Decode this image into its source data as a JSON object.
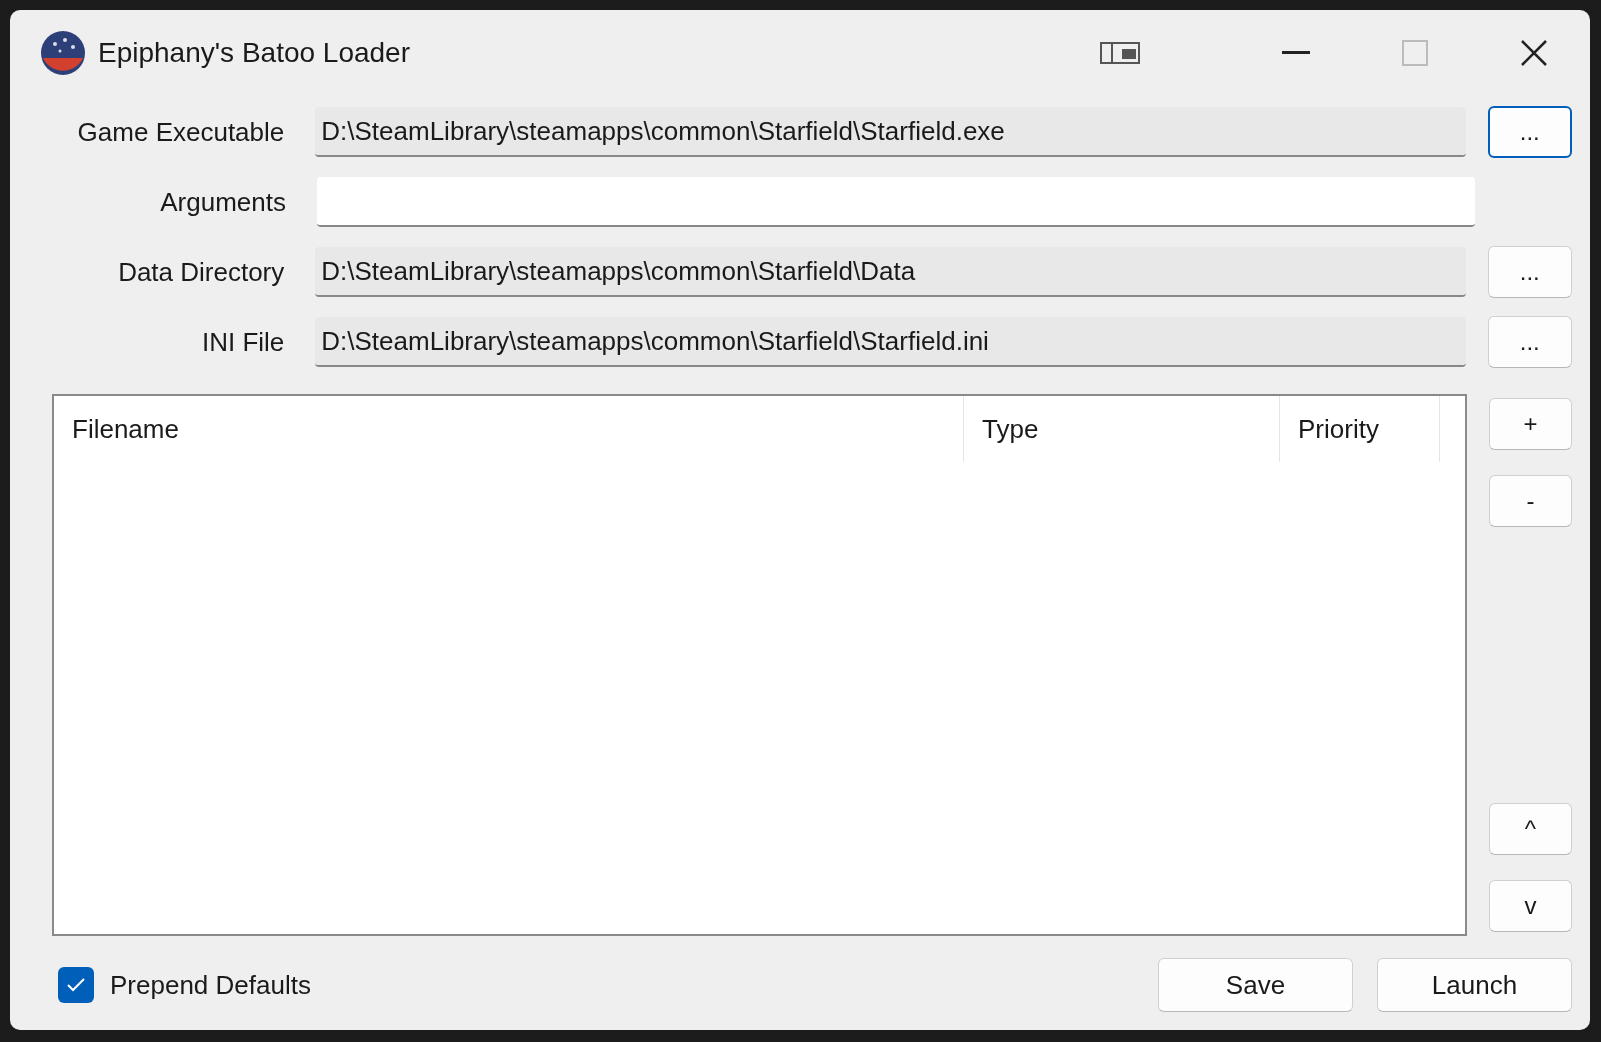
{
  "window": {
    "title": "Epiphany's Batoo Loader"
  },
  "fields": [
    {
      "label": "Game Executable",
      "value": "D:\\SteamLibrary\\steamapps\\common\\Starfield\\Starfield.exe",
      "readonly": true,
      "browse": {
        "label": "...",
        "focused": true
      }
    },
    {
      "label": "Arguments",
      "readonly": false
    },
    {
      "label": "Data Directory",
      "value": "D:\\SteamLibrary\\steamapps\\common\\Starfield\\Data",
      "readonly": true,
      "browse": {
        "label": "...",
        "focused": false
      }
    },
    {
      "label": "INI File",
      "value": "D:\\SteamLibrary\\steamapps\\common\\Starfield\\Starfield.ini",
      "readonly": true,
      "browse": {
        "label": "...",
        "focused": false
      }
    }
  ],
  "table": {
    "columns": [
      "Filename",
      "Type",
      "Priority"
    ]
  },
  "side_buttons": {
    "top": [
      "+",
      "-"
    ],
    "bottom": [
      "^",
      "v"
    ]
  },
  "prepend_defaults": {
    "label": "Prepend Defaults",
    "checked": true
  },
  "buttons": [
    "Save",
    "Launch"
  ]
}
